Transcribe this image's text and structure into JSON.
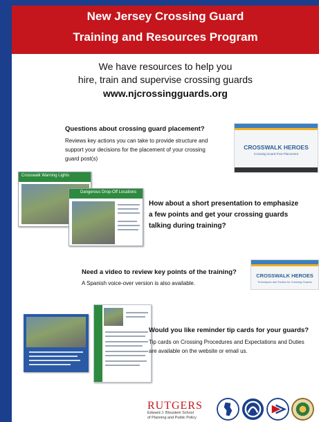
{
  "banner": {
    "line1": "New Jersey Crossing Guard",
    "line2": "Training and Resources Program"
  },
  "intro": {
    "line1": "We have resources to help you",
    "line2": "hire, train and supervise crossing guards",
    "url": "www.njcrossingguards.org"
  },
  "sections": [
    {
      "question": "Questions about crossing guard placement?",
      "description_lines": [
        "Reviews key actions you can take to provide structure and",
        "support your decisions for the placement of your crossing",
        "guard post(s)"
      ]
    },
    {
      "question_lines": [
        "How about a short presentation to emphasize",
        "a few points and get your crossing guards",
        "talking during training?"
      ]
    },
    {
      "question": "Need a video to review key points of the training?",
      "description_lines": [
        "A Spanish voice-over version is also available."
      ]
    },
    {
      "question": "Would you like reminder tip cards for your guards?",
      "description_lines": [
        "Tip cards on Crossing Procedures and Expectations and Duties",
        "are  available on the website or email us."
      ]
    }
  ],
  "video_thumbs": [
    {
      "title": "CROSSWALK HEROES",
      "subtitle": "Crossing Guard Post Placement"
    },
    {
      "title": "CROSSWALK HEROES",
      "subtitle": "Techniques and Tactics for Crossing Guards"
    }
  ],
  "slides": [
    {
      "title": "Crosswalk Warning Lights"
    },
    {
      "title": "Dangerous Drop-Off Locations"
    }
  ],
  "footer": {
    "rutgers": "RUTGERS",
    "school_line1": "Edward J. Bloustein School",
    "school_line2": "of Planning and Public Policy"
  },
  "colors": {
    "banner": "#c4161c",
    "background": "#1b3f8c",
    "video_title": "#2c5e94"
  }
}
